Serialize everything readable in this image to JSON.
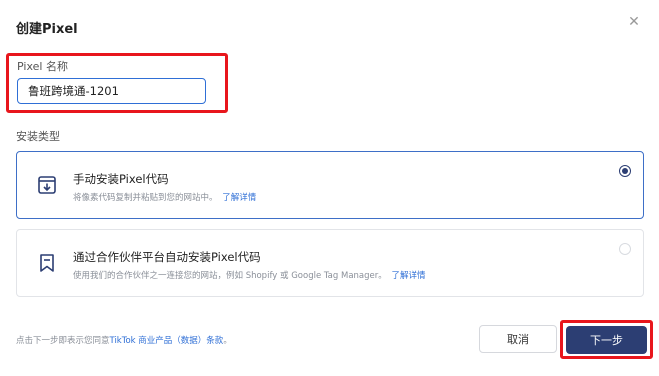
{
  "dialog": {
    "title": "创建Pixel",
    "close_icon": "close-icon"
  },
  "pixel_name": {
    "label": "Pixel 名称",
    "value": "鲁班跨境通-1201"
  },
  "install_type": {
    "label": "安装类型",
    "options": [
      {
        "icon": "download-box-icon",
        "title": "手动安装Pixel代码",
        "description": "将像素代码复制并粘贴到您的网站中。",
        "link": "了解详情",
        "selected": true
      },
      {
        "icon": "bookmark-icon",
        "title": "通过合作伙伴平台自动安装Pixel代码",
        "description": "使用我们的合作伙伴之一连接您的网站，例如 Shopify 或 Google Tag Manager。",
        "link": "了解详情",
        "selected": false
      }
    ]
  },
  "footer": {
    "terms_prefix": "点击下一步即表示您同意",
    "terms_link": "TikTok 商业产品（数据）条款",
    "terms_suffix": "。",
    "cancel_label": "取消",
    "next_label": "下一步"
  },
  "colors": {
    "primary": "#2c3e73",
    "link": "#2f6fd6",
    "highlight": "#e8161c"
  }
}
